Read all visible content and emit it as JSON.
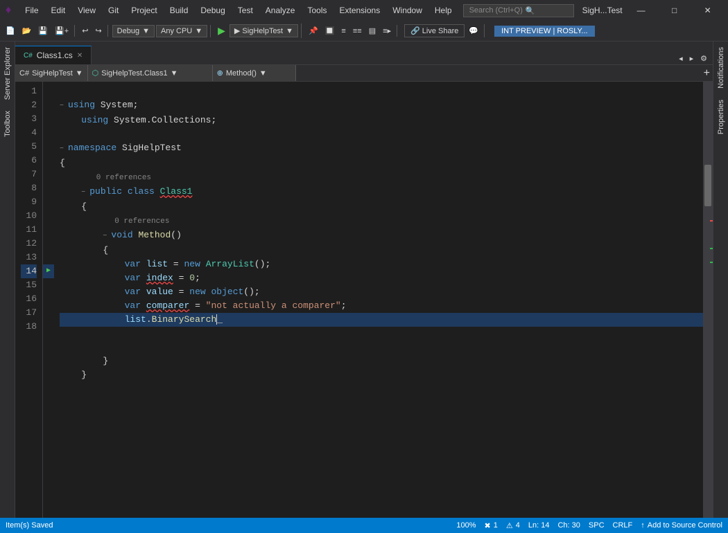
{
  "titlebar": {
    "logo": "♦",
    "menu_items": [
      "File",
      "Edit",
      "View",
      "Git",
      "Project",
      "Build",
      "Debug",
      "Test",
      "Analyze",
      "Tools",
      "Extensions",
      "Window",
      "Help"
    ],
    "search_placeholder": "Search (Ctrl+Q)",
    "window_title": "SigH...Test",
    "minimize": "—",
    "maximize": "□",
    "close": "✕"
  },
  "toolbar": {
    "undo": "↩",
    "redo": "↪",
    "debug_config": "Debug",
    "platform": "Any CPU",
    "run_label": "▶ SigHelpTest",
    "live_share": "🔗 Live Share",
    "int_preview": "INT PREVIEW | ROSLY..."
  },
  "tabs": {
    "active_tab": "Class1.cs",
    "close_icon": "✕"
  },
  "nav": {
    "project": "SigHelpTest",
    "class": "SigHelpTest.Class1",
    "member": "Method()"
  },
  "code": {
    "lines": [
      {
        "num": 1,
        "indent": 0,
        "collapse": "−",
        "text": "using System;",
        "tokens": [
          {
            "t": "kw",
            "v": "using"
          },
          {
            "t": "",
            "v": " System;"
          }
        ]
      },
      {
        "num": 2,
        "indent": 1,
        "collapse": "",
        "text": "    using System.Collections;",
        "tokens": [
          {
            "t": "kw",
            "v": "    using"
          },
          {
            "t": "",
            "v": " System.Collections;"
          }
        ]
      },
      {
        "num": 3,
        "indent": 0,
        "collapse": "",
        "text": ""
      },
      {
        "num": 4,
        "indent": 0,
        "collapse": "−",
        "text": "namespace SigHelpTest",
        "tokens": [
          {
            "t": "kw",
            "v": "namespace"
          },
          {
            "t": "",
            "v": " SigHelpTest"
          }
        ]
      },
      {
        "num": 5,
        "indent": 0,
        "collapse": "",
        "text": "{"
      },
      {
        "num": 6,
        "indent": 1,
        "collapse": "−",
        "refs": "0 references",
        "text": "    public class Class1",
        "tokens": [
          {
            "t": "kw",
            "v": "    public"
          },
          {
            "t": "kw",
            "v": " class"
          },
          {
            "t": "type",
            "v": " Class1"
          }
        ]
      },
      {
        "num": 7,
        "indent": 1,
        "collapse": "",
        "text": "    {"
      },
      {
        "num": 8,
        "indent": 2,
        "collapse": "−",
        "refs": "0 references",
        "text": "        void Method()",
        "tokens": [
          {
            "t": "kw",
            "v": "        void"
          },
          {
            "t": "method",
            "v": " Method"
          },
          {
            "t": "",
            "v": "()"
          }
        ]
      },
      {
        "num": 9,
        "indent": 2,
        "collapse": "",
        "text": "        {"
      },
      {
        "num": 10,
        "indent": 3,
        "collapse": "",
        "text": "            var list = new ArrayList();"
      },
      {
        "num": 11,
        "indent": 3,
        "collapse": "",
        "text": "            var index = 0;"
      },
      {
        "num": 12,
        "indent": 3,
        "collapse": "",
        "text": "            var value = new object();"
      },
      {
        "num": 13,
        "indent": 3,
        "collapse": "",
        "text": "            var comparer = \"not actually a comparer\";"
      },
      {
        "num": 14,
        "indent": 3,
        "collapse": "",
        "text": "            list.BinarySearch",
        "active": true
      },
      {
        "num": 15,
        "indent": 2,
        "collapse": "",
        "text": ""
      },
      {
        "num": 16,
        "indent": 2,
        "collapse": "",
        "text": "        }"
      },
      {
        "num": 17,
        "indent": 1,
        "collapse": "",
        "text": "    }"
      },
      {
        "num": 18,
        "indent": 0,
        "collapse": "",
        "text": ""
      }
    ]
  },
  "statusbar": {
    "items_saved": "Item(s) Saved",
    "source_control_icon": "↑",
    "source_control": "Add to Source Control",
    "zoom": "100%",
    "errors": "1",
    "warnings": "4",
    "ln": "Ln: 14",
    "ch": "Ch: 30",
    "spc": "SPC",
    "crlf": "CRLF"
  },
  "sidebar_left": {
    "server_explorer": "Server Explorer",
    "toolbox": "Toolbox"
  },
  "sidebar_right": {
    "notifications": "Notifications",
    "properties": "Properties"
  }
}
